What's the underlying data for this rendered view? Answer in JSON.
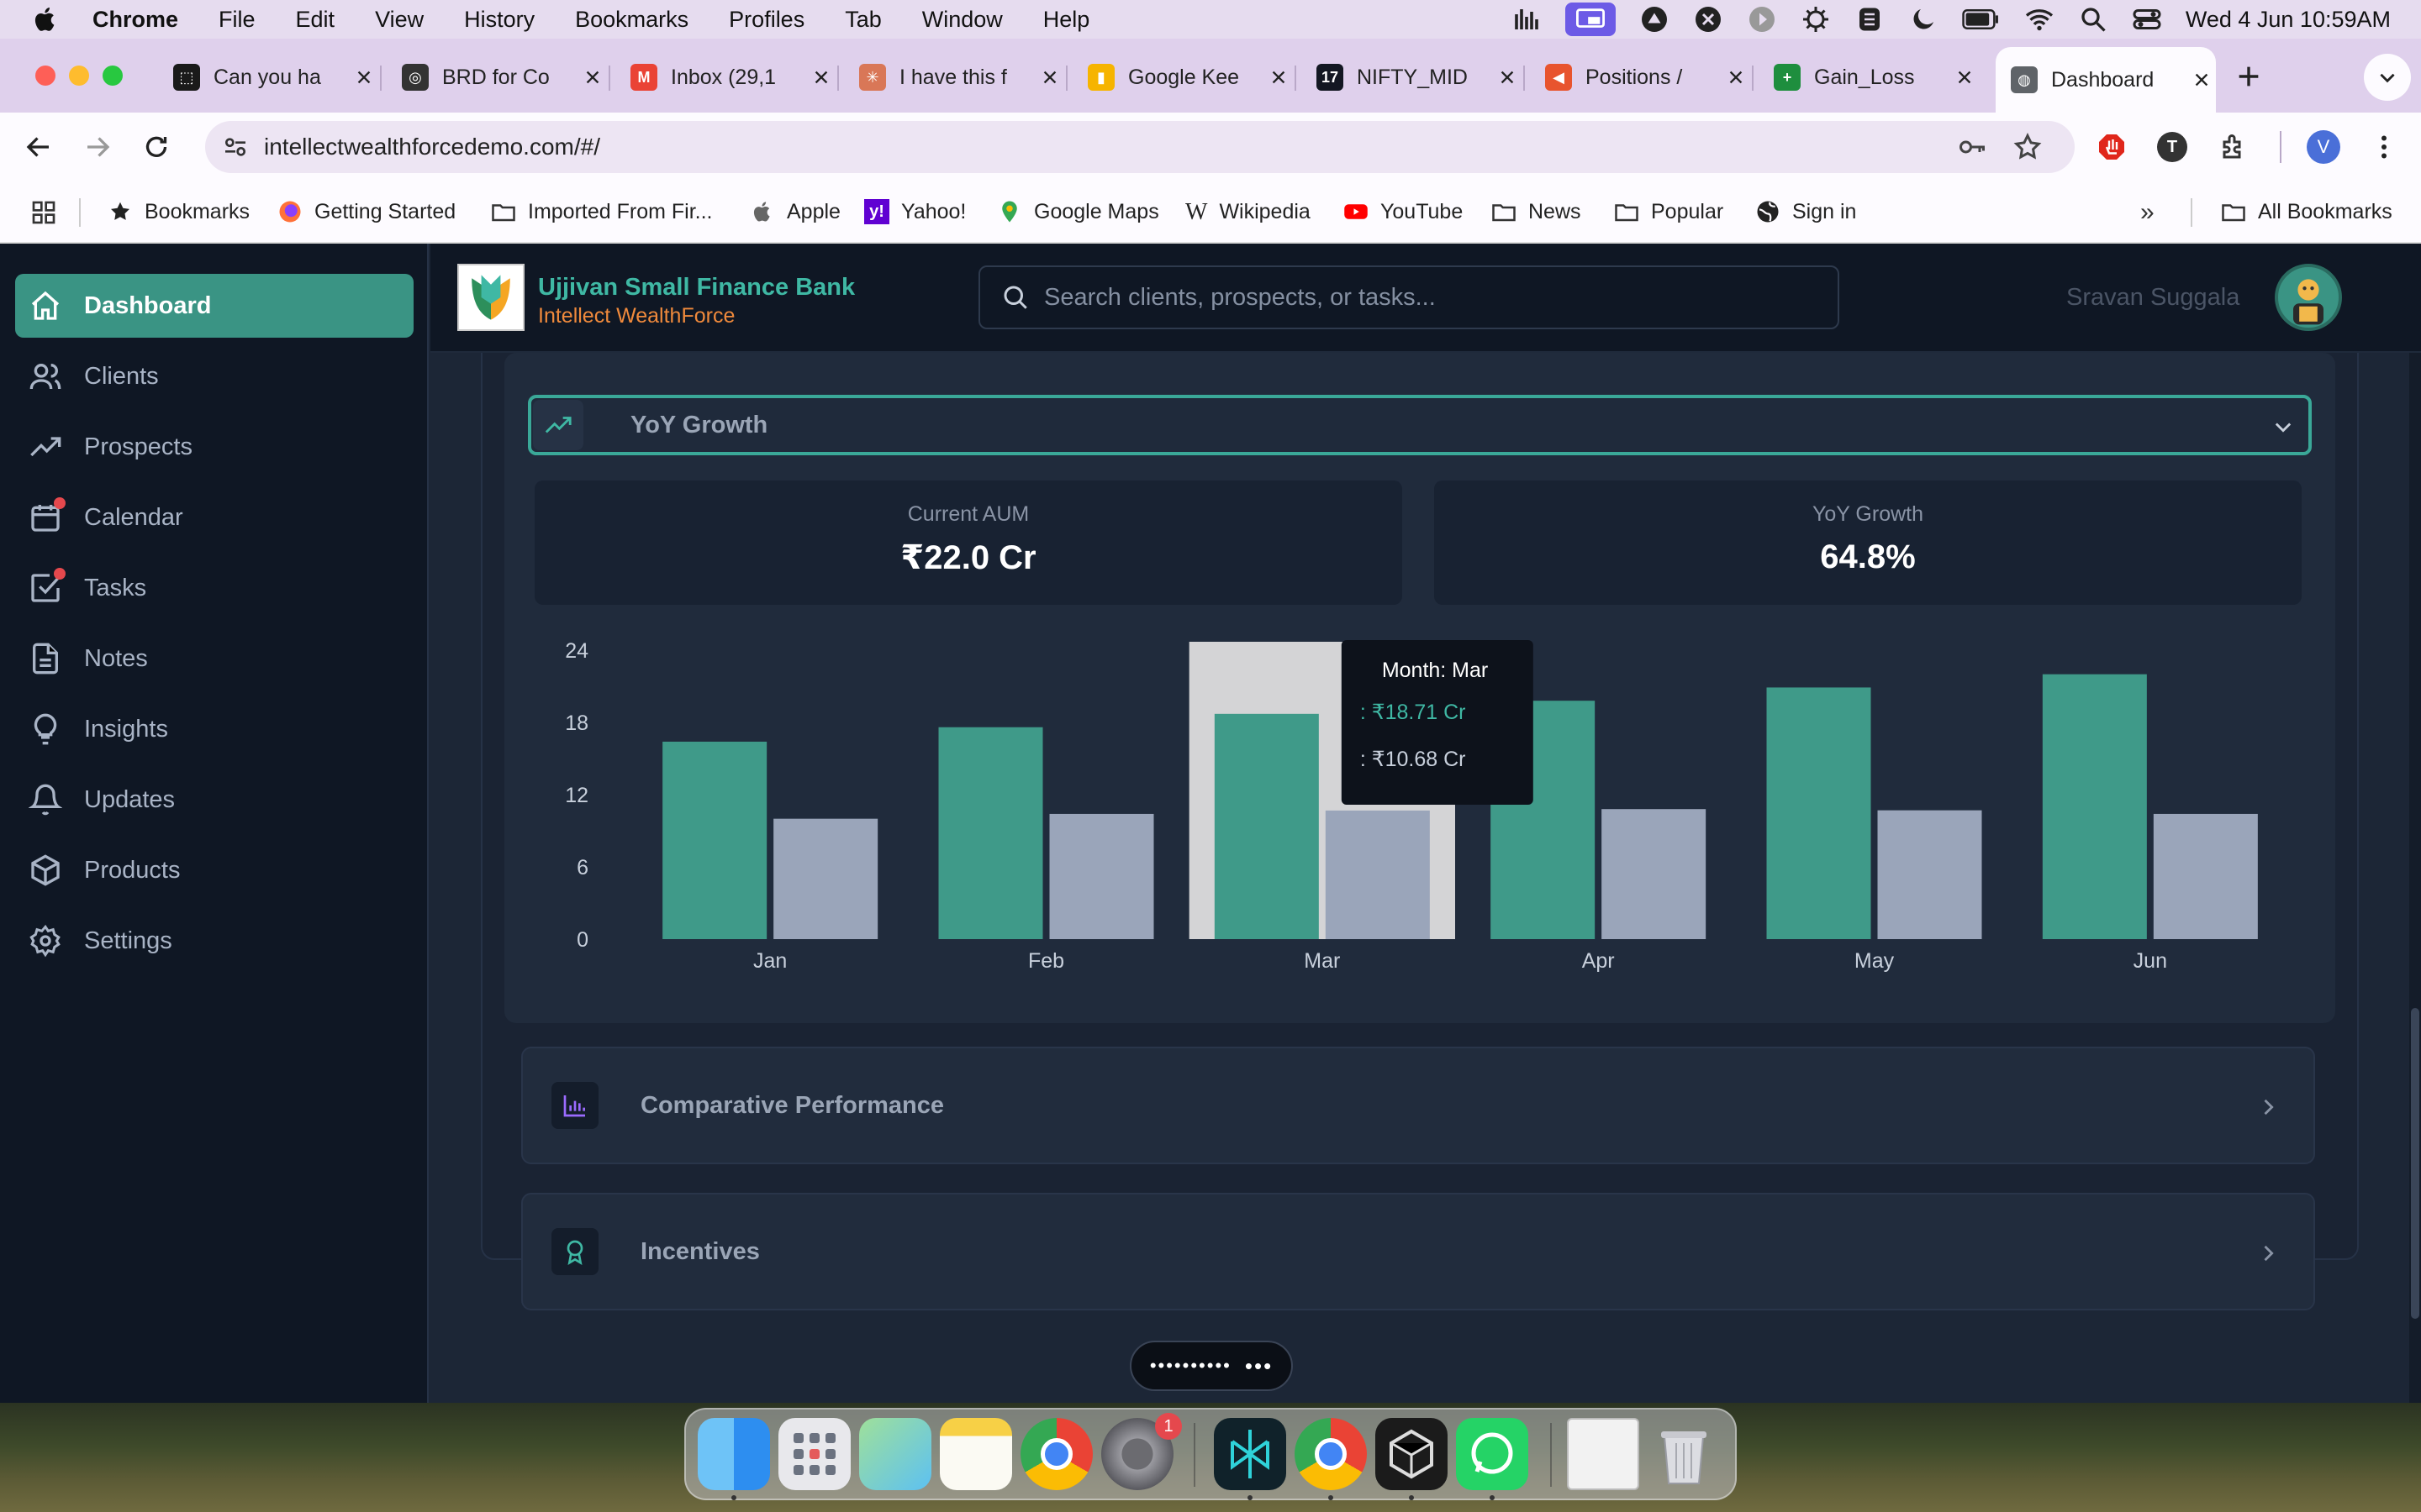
{
  "menubar": {
    "app_name": "Chrome",
    "items": [
      "File",
      "Edit",
      "View",
      "History",
      "Bookmarks",
      "Profiles",
      "Tab",
      "Window",
      "Help"
    ],
    "datetime": "Wed 4 Jun  10:59AM"
  },
  "tabs": [
    {
      "title": "Can you ha",
      "favicon_color": "#1a1a1a",
      "favicon_glyph": "⬚"
    },
    {
      "title": "BRD for Co",
      "favicon_color": "#333333",
      "favicon_glyph": "◎"
    },
    {
      "title": "Inbox (29,1",
      "favicon_color": "#ea4335",
      "favicon_glyph": "M"
    },
    {
      "title": "I have this f",
      "favicon_color": "#d97757",
      "favicon_glyph": "✳"
    },
    {
      "title": "Google Kee",
      "favicon_color": "#f6b400",
      "favicon_glyph": "▮"
    },
    {
      "title": "NIFTY_MID",
      "favicon_color": "#131722",
      "favicon_glyph": "17"
    },
    {
      "title": "Positions / ",
      "favicon_color": "#e8542e",
      "favicon_glyph": "◀"
    },
    {
      "title": "Gain_Loss ",
      "favicon_color": "#1e8e3e",
      "favicon_glyph": "+"
    },
    {
      "title": "Dashboard",
      "favicon_color": "#5f6368",
      "favicon_glyph": "◍",
      "active": true
    }
  ],
  "toolbar": {
    "url": "intellectwealthforcedemo.com/#/",
    "profile_initial": "V",
    "extension_initial": "T"
  },
  "bookmarks": {
    "items": [
      "Bookmarks",
      "Getting Started",
      "Imported From Fir...",
      "Apple",
      "Yahoo!",
      "Google Maps",
      "Wikipedia",
      "YouTube",
      "News",
      "Popular",
      "Sign in"
    ],
    "all_label": "All Bookmarks"
  },
  "sidebar": {
    "items": [
      {
        "label": "Dashboard",
        "icon": "home-icon",
        "active": true
      },
      {
        "label": "Clients",
        "icon": "users-icon"
      },
      {
        "label": "Prospects",
        "icon": "trending-up-icon"
      },
      {
        "label": "Calendar",
        "icon": "calendar-icon",
        "badge": true
      },
      {
        "label": "Tasks",
        "icon": "check-square-icon",
        "badge": true
      },
      {
        "label": "Notes",
        "icon": "file-text-icon"
      },
      {
        "label": "Insights",
        "icon": "lightbulb-icon"
      },
      {
        "label": "Updates",
        "icon": "bell-icon"
      },
      {
        "label": "Products",
        "icon": "package-icon"
      },
      {
        "label": "Settings",
        "icon": "gear-icon"
      }
    ]
  },
  "header": {
    "bank_name": "Ujjivan Small Finance Bank",
    "product_name": "Intellect WealthForce",
    "search_placeholder": "Search clients, prospects, or tasks...",
    "user_name": "Sravan Suggala"
  },
  "colors": {
    "accent": "#3a9484",
    "bar_primary": "#3f9a89",
    "bar_secondary": "#9aa5ba"
  },
  "yoy_section": {
    "title": "YoY Growth",
    "stats": [
      {
        "label": "Current AUM",
        "value": "₹22.0 Cr"
      },
      {
        "label": "YoY Growth",
        "value": "64.8%"
      }
    ],
    "tooltip": {
      "title": "Month: Mar",
      "line1": ": ₹18.71 Cr",
      "line2": ": ₹10.68 Cr"
    }
  },
  "chart_data": {
    "type": "bar",
    "categories": [
      "Jan",
      "Feb",
      "Mar",
      "Apr",
      "May",
      "Jun"
    ],
    "series": [
      {
        "values": [
          16.4,
          17.6,
          18.71,
          19.8,
          20.9,
          22.0
        ]
      },
      {
        "values": [
          10.0,
          10.4,
          10.68,
          10.8,
          10.7,
          10.4
        ]
      }
    ],
    "yticks": [
      0,
      6,
      12,
      18,
      24
    ],
    "ylim": [
      0,
      24
    ],
    "highlighted_category": "Mar",
    "grid": false
  },
  "sections": [
    {
      "title": "Comparative Performance",
      "icon": "bar-chart-icon"
    },
    {
      "title": "Incentives",
      "icon": "award-icon"
    }
  ],
  "dock": {
    "settings_badge": "1"
  }
}
